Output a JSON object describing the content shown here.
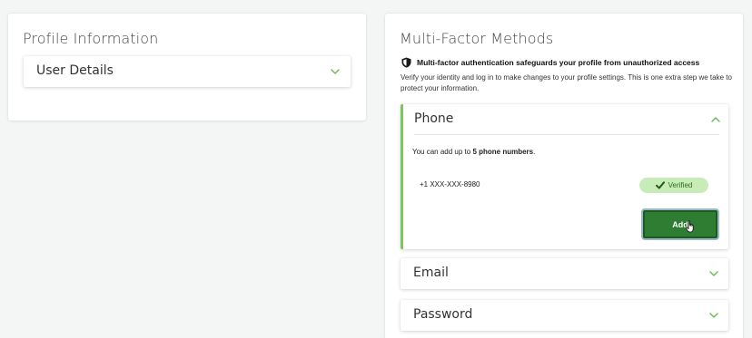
{
  "profile": {
    "title": "Profile Information",
    "user_details_label": "User Details"
  },
  "mfa": {
    "title": "Multi-Factor Methods",
    "info_heading": "Multi-factor authentication safeguards your profile from unauthorized access",
    "description": "Verify your identity and log in to make changes to your profile settings. This is one extra step we take to protect your information.",
    "phone": {
      "label": "Phone",
      "limit_prefix": "You can add up to ",
      "limit_bold": "5 phone numbers",
      "limit_suffix": ".",
      "number": "+1 XXX-XXX-8980",
      "status": "Verified",
      "add_label": "Add"
    },
    "email_label": "Email",
    "password_label": "Password"
  },
  "colors": {
    "accent_green": "#7fc561",
    "button_green": "#2e7d32",
    "verified_bg": "#c8ecb7"
  },
  "icons": [
    "chevron-down-icon",
    "chevron-up-icon",
    "shield-icon",
    "check-icon",
    "hand-cursor-icon"
  ]
}
